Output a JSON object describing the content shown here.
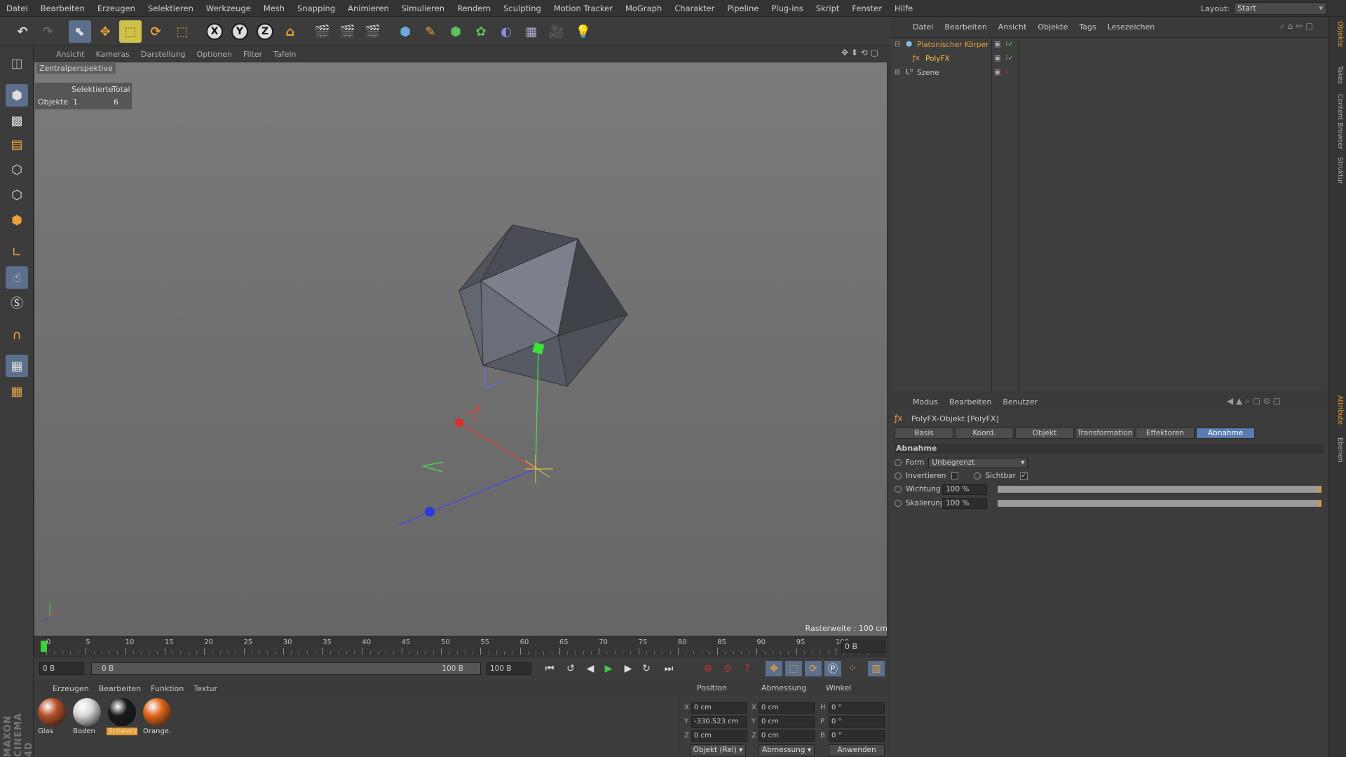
{
  "menu": [
    "Datei",
    "Bearbeiten",
    "Erzeugen",
    "Selektieren",
    "Werkzeuge",
    "Mesh",
    "Snapping",
    "Animieren",
    "Simulieren",
    "Rendern",
    "Sculpting",
    "Motion Tracker",
    "MoGraph",
    "Charakter",
    "Pipeline",
    "Plug-ins",
    "Skript",
    "Fenster",
    "Hilfe"
  ],
  "layout": {
    "label": "Layout:",
    "value": "Start"
  },
  "toolbar": {
    "undo_icon": "undo-icon",
    "redo_icon": "redo-icon",
    "axis_x": "X",
    "axis_y": "Y",
    "axis_z": "Z"
  },
  "viewport": {
    "menu": [
      "Ansicht",
      "Kameras",
      "Darstellung",
      "Optionen",
      "Filter",
      "Tafeln"
    ],
    "camera": "Zentralperspektive",
    "stats": {
      "col1": "Selektierte",
      "col2": "Total",
      "row_label": "Objekte",
      "selected": "1",
      "total": "6"
    },
    "grid_info": "Rasterweite : 100 cm"
  },
  "timeline": {
    "ticks": [
      "0",
      "5",
      "10",
      "15",
      "20",
      "25",
      "30",
      "35",
      "40",
      "45",
      "50",
      "55",
      "60",
      "65",
      "70",
      "75",
      "80",
      "85",
      "90",
      "95",
      "100"
    ],
    "end_field": "0 B",
    "start_field": "0 B",
    "range_start": "0 B",
    "range_end": "100 B",
    "max_field": "100 B"
  },
  "materials": {
    "menu": [
      "Erzeugen",
      "Bearbeiten",
      "Funktion",
      "Textur"
    ],
    "items": [
      {
        "label": "Glas",
        "color": "#b5512a"
      },
      {
        "label": "Boden",
        "color": "#d8d8d8"
      },
      {
        "label": "Schwarz",
        "color": "#1a1a1a"
      },
      {
        "label": "Orange.",
        "color": "#e0661a"
      }
    ]
  },
  "coords": {
    "headers": [
      "Position",
      "Abmessung",
      "Winkel"
    ],
    "pos_labels": [
      "X",
      "Y",
      "Z"
    ],
    "size_labels": [
      "X",
      "Y",
      "Z"
    ],
    "rot_labels": [
      "H",
      "P",
      "B"
    ],
    "pos": [
      "0 cm",
      "-330.523 cm",
      "0 cm"
    ],
    "size": [
      "0 cm",
      "0 cm",
      "0 cm"
    ],
    "rot": [
      "0 °",
      "0 °",
      "0 °"
    ],
    "mode": "Objekt (Rel)",
    "size_mode": "Abmessung",
    "apply": "Anwenden"
  },
  "objects": {
    "menu": [
      "Datei",
      "Bearbeiten",
      "Ansicht",
      "Objekte",
      "Tags",
      "Lesezeichen"
    ],
    "rows": [
      {
        "name": "Platonischer Körper",
        "color": "#e8a23c"
      },
      {
        "name": "PolyFX",
        "color": "#f0c040"
      },
      {
        "name": "Szene",
        "color": "#c8c8c8"
      }
    ]
  },
  "attributes": {
    "menu": [
      "Modus",
      "Bearbeiten",
      "Benutzer"
    ],
    "title": "PolyFX-Objekt [PolyFX]",
    "tabs": [
      "Basis",
      "Koord.",
      "Objekt",
      "Transformation",
      "Effektoren",
      "Abnahme"
    ],
    "active_tab": "Abnahme",
    "section": "Abnahme",
    "form_label": "Form",
    "form_value": "Unbegrenzt",
    "invert_label": "Invertieren",
    "visible_label": "Sichtbar",
    "weight_label": "Wichtung",
    "weight_value": "100 %",
    "scale_label": "Skalierung",
    "scale_value": "100 %",
    "weight_fraction": 1.0,
    "scale_fraction": 1.0
  },
  "side_tabs": [
    "Objekte",
    "Takes",
    "Content Browser",
    "Struktur",
    "Attribute",
    "Ebenen"
  ],
  "brand": "MAXON CINEMA 4D"
}
